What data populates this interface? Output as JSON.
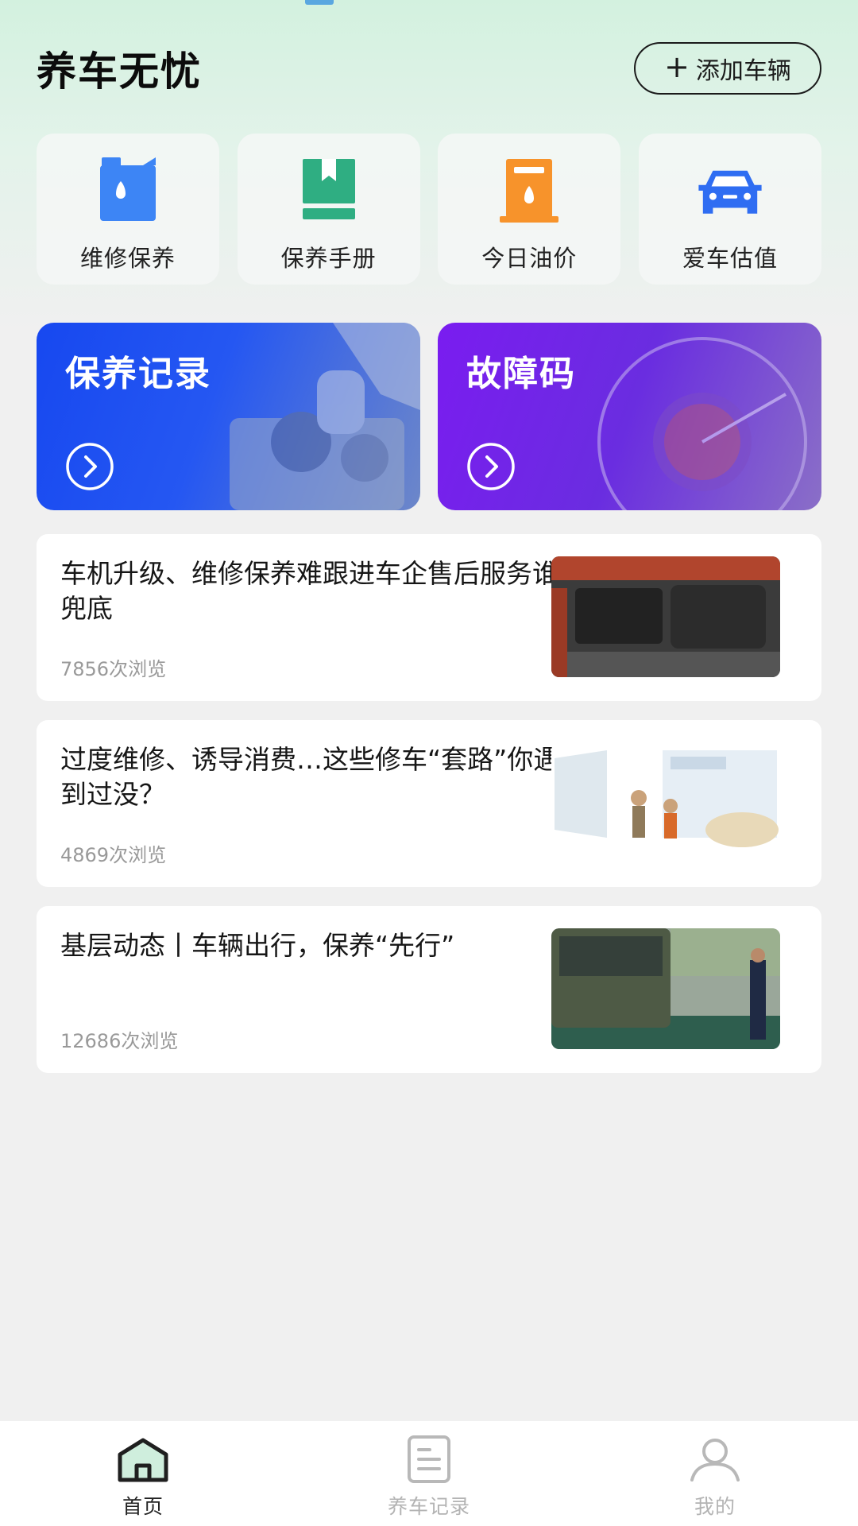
{
  "header": {
    "title": "养车无忧",
    "add_vehicle_label": "添加车辆"
  },
  "quick_actions": [
    {
      "label": "维修保养",
      "icon": "oil-can-icon",
      "color": "#3d85f5"
    },
    {
      "label": "保养手册",
      "icon": "manual-book-icon",
      "color": "#2fae82"
    },
    {
      "label": "今日油价",
      "icon": "fuel-pump-icon",
      "color": "#f7932b"
    },
    {
      "label": "爱车估值",
      "icon": "car-icon",
      "color": "#2f6df2"
    }
  ],
  "banners": [
    {
      "title": "保养记录",
      "color": "#1748f0"
    },
    {
      "title": "故障码",
      "color": "#7a1cf0"
    }
  ],
  "news": [
    {
      "title": "车机升级、维修保养难跟进车企售后服务谁兜底",
      "views": "7856次浏览"
    },
    {
      "title": "过度维修、诱导消费…这些修车“套路”你遇到过没？",
      "views": "4869次浏览"
    },
    {
      "title": "基层动态丨车辆出行，保养“先行”",
      "views": "12686次浏览"
    }
  ],
  "tabbar": {
    "items": [
      {
        "label": "首页",
        "icon": "home-icon",
        "active": true
      },
      {
        "label": "养车记录",
        "icon": "document-icon",
        "active": false
      },
      {
        "label": "我的",
        "icon": "user-icon",
        "active": false
      }
    ]
  }
}
